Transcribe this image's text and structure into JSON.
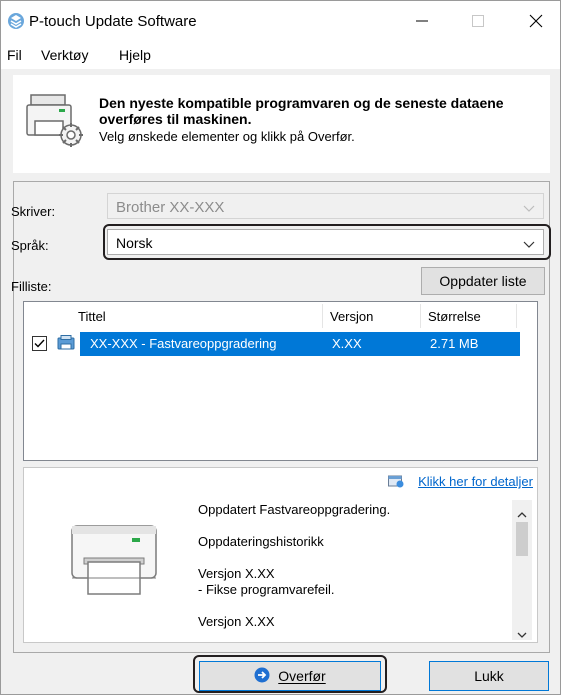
{
  "window": {
    "title": "P-touch Update Software",
    "icons": {
      "app": "ptouch-app-icon",
      "minimize": "minimize-icon",
      "maximize": "maximize-icon",
      "close": "close-icon"
    }
  },
  "menu": {
    "items": [
      "Fil",
      "Verktøy",
      "Hjelp"
    ]
  },
  "header": {
    "title": "Den nyeste kompatible programvaren og de seneste dataene overføres til maskinen.",
    "subtitle": "Velg ønskede elementer og klikk på Overfør."
  },
  "form": {
    "printer_label": "Skriver:",
    "printer_value": "Brother XX-XXX",
    "language_label": "Språk:",
    "language_value": "Norsk",
    "filelist_label": "Filliste:",
    "refresh_button": "Oppdater liste"
  },
  "file_table": {
    "columns": [
      "Tittel",
      "Versjon",
      "Størrelse"
    ],
    "rows": [
      {
        "checked": true,
        "title": "XX-XXX  - Fastvareoppgradering",
        "version": "X.XX",
        "size": "2.71 MB"
      }
    ]
  },
  "details": {
    "link": "Klikk her for detaljer",
    "lines": [
      "Oppdatert  Fastvareoppgradering.",
      "Oppdateringshistorikk",
      "Versjon X.XX",
      "- Fikse programvarefeil.",
      "Versjon X.XX"
    ]
  },
  "buttons": {
    "transfer": "Overfør",
    "close": "Lukk"
  },
  "colors": {
    "selection": "#0078d7",
    "link": "#0066cc",
    "window_bg": "#f0f0f0"
  }
}
